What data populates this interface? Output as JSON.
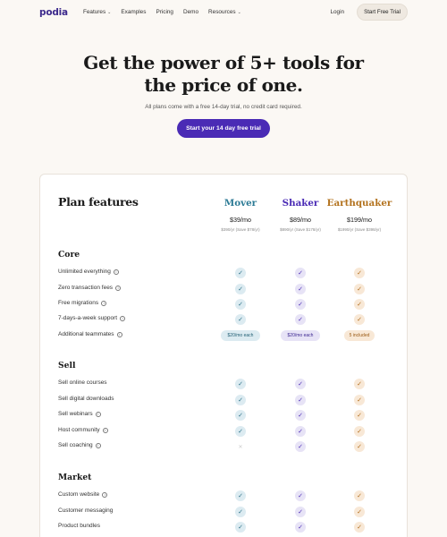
{
  "nav": {
    "logo": "podia",
    "links": [
      "Features",
      "Examples",
      "Pricing",
      "Demo",
      "Resources"
    ],
    "login": "Login",
    "cta": "Start Free Trial"
  },
  "hero": {
    "title_line1": "Get the power of 5+ tools for",
    "title_line2": "the price of one.",
    "subtitle": "All plans come with a free 14-day trial, no credit card required.",
    "cta": "Start your 14 day free trial"
  },
  "plans_title": "Plan features",
  "plans": [
    {
      "name": "Mover",
      "price": "$39/mo",
      "year": "$390/yr (Save $78/yr)",
      "color": "#2b7a95"
    },
    {
      "name": "Shaker",
      "price": "$89/mo",
      "year": "$890/yr (Save $178/yr)",
      "color": "#4a2bb5"
    },
    {
      "name": "Earthquaker",
      "price": "$199/mo",
      "year": "$1990/yr (Save $398/yr)",
      "color": "#b3731f"
    }
  ],
  "sections": {
    "core": "Core",
    "sell": "Sell",
    "market": "Market"
  },
  "features": {
    "unlimited": "Unlimited everything",
    "zero_fees": "Zero transaction fees",
    "migrations": "Free migrations",
    "support": "7-days-a-week support",
    "teammates": "Additional teammates",
    "courses": "Sell online courses",
    "downloads": "Sell digital downloads",
    "webinars": "Sell webinars",
    "community": "Host community",
    "coaching": "Sell coaching",
    "website": "Custom website",
    "messaging": "Customer messaging",
    "bundles": "Product bundles"
  },
  "teammates_values": {
    "mover": "$20/mo each",
    "shaker": "$20/mo each",
    "earth": "5 included"
  }
}
